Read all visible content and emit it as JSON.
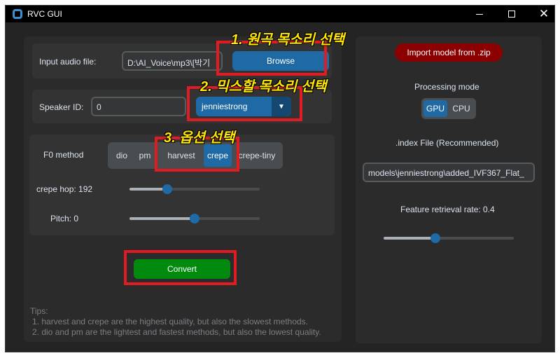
{
  "window": {
    "title": "RVC GUI"
  },
  "audio": {
    "label": "Input audio file:",
    "path": "D:\\AI_Voice\\mp3\\[박기",
    "browse_label": "Browse"
  },
  "speaker": {
    "label": "Speaker ID:",
    "value": "0",
    "model": "jenniestrong"
  },
  "f0": {
    "label": "F0 method",
    "options": [
      "dio",
      "pm",
      "harvest",
      "crepe",
      "crepe-tiny"
    ],
    "selected": "crepe",
    "crepe_hop_label": "crepe hop: 192",
    "crepe_hop_value": 192,
    "pitch_label": "Pitch: 0",
    "pitch_value": 0
  },
  "convert_label": "Convert",
  "tips": {
    "title": "Tips:",
    "lines": [
      "1. harvest and crepe are the highest quality, but also the slowest methods.",
      "2. dio and pm are the lightest and fastest methods, but also the lowest quality."
    ]
  },
  "right": {
    "import_label": "Import model from .zip",
    "processing_label": "Processing mode",
    "modes": [
      "GPU",
      "CPU"
    ],
    "selected_mode": "GPU",
    "index_label": ".index File (Recommended)",
    "index_path": "models\\jenniestrong\\added_IVF367_Flat_",
    "feature_label": "Feature retrieval rate: 0.4",
    "feature_value": 0.4
  },
  "annotations": [
    "1. 원곡 목소리 선택",
    "2. 믹스할 목소리 선택",
    "3. 옵션 선택"
  ],
  "colors": {
    "accent": "#1f6aa5",
    "convert": "#028a0f",
    "import": "#8b0000",
    "annotation_box": "#e11b22",
    "annotation_text": "#ffe600"
  }
}
